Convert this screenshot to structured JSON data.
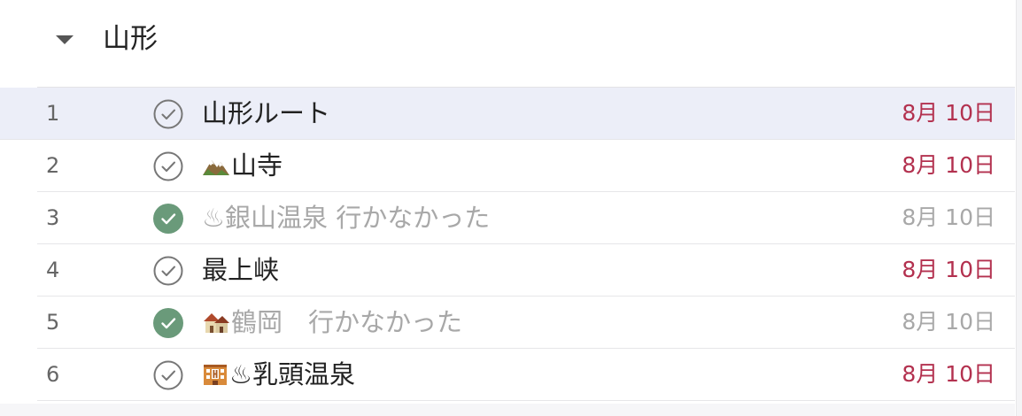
{
  "section": {
    "title": "山形",
    "toggle_icon": "caret-down-icon"
  },
  "tasks": [
    {
      "number": "1",
      "title": "山形ルート",
      "emoji": "",
      "date": "8月 10日",
      "completed": false,
      "selected": true
    },
    {
      "number": "2",
      "title": "山寺",
      "emoji": "mountain-icon",
      "date": "8月 10日",
      "completed": false,
      "selected": false
    },
    {
      "number": "3",
      "title": "♨銀山温泉 行かなかった",
      "emoji": "",
      "date": "8月 10日",
      "completed": true,
      "selected": false
    },
    {
      "number": "4",
      "title": "最上峡",
      "emoji": "",
      "date": "8月 10日",
      "completed": false,
      "selected": false
    },
    {
      "number": "5",
      "title": "鶴岡　行かなかった",
      "emoji": "houses-icon",
      "date": "8月 10日",
      "completed": true,
      "selected": false
    },
    {
      "number": "6",
      "title": "♨乳頭温泉",
      "emoji": "hotel-icon",
      "date": "8月 10日",
      "completed": false,
      "selected": false
    }
  ],
  "colors": {
    "due_date": "#b3314f",
    "completed_check": "#6a9a7a",
    "completed_text": "#a8a8a8",
    "selected_row": "#eceef8"
  }
}
